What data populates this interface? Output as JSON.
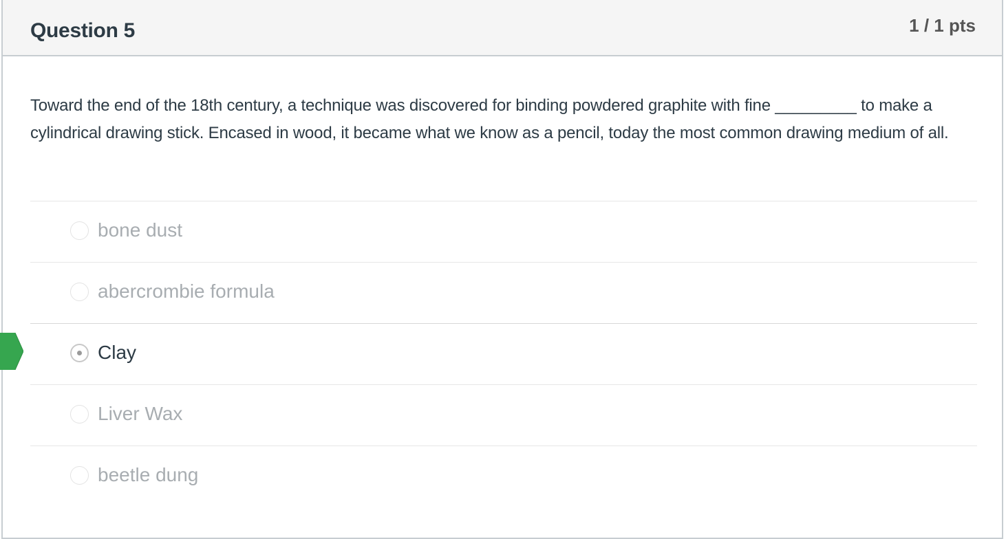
{
  "question": {
    "title": "Question 5",
    "points": "1 / 1 pts",
    "text": "Toward the end of the 18th century, a technique was discovered for binding powdered graphite with fine _________ to make a cylindrical drawing stick. Encased in wood, it became what we know as a pencil, today the most common drawing medium of all."
  },
  "answers": [
    {
      "label": "bone dust",
      "selected": false
    },
    {
      "label": "abercrombie formula",
      "selected": false
    },
    {
      "label": "Clay",
      "selected": true
    },
    {
      "label": "Liver Wax",
      "selected": false
    },
    {
      "label": "beetle dung",
      "selected": false
    }
  ],
  "colors": {
    "correct_marker": "#36a64f",
    "selected_text": "#2d3b45",
    "unselected_text": "#a8adb1"
  },
  "icons": {
    "correct_marker": "correct-answer-arrow-icon"
  }
}
